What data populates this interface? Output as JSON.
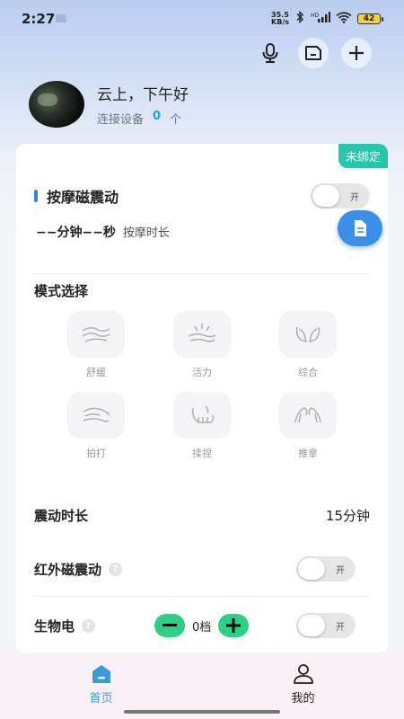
{
  "status_bar": {
    "time": "2:27",
    "net_speed_value": "35.5",
    "net_speed_unit": "KB/s",
    "wifi_tag": "HD",
    "battery": "42"
  },
  "header": {
    "greeting": "云上，下午好",
    "connected_label": "连接设备",
    "connected_count": "0",
    "connected_unit": "个"
  },
  "card": {
    "bind_status": "未绑定",
    "section_title": "按摩磁震动",
    "main_toggle_label": "开",
    "duration_value": "−−分钟−−秒",
    "duration_label": "按摩时长",
    "mode_title": "模式选择",
    "modes": [
      {
        "label": "舒缓",
        "icon": "wave-hand-icon"
      },
      {
        "label": "活力",
        "icon": "sparkle-hand-icon"
      },
      {
        "label": "综合",
        "icon": "two-hands-icon"
      },
      {
        "label": "拍打",
        "icon": "tap-hand-icon"
      },
      {
        "label": "揉捏",
        "icon": "knead-hand-icon"
      },
      {
        "label": "推拿",
        "icon": "push-hands-icon"
      }
    ],
    "vibration_duration_label": "震动时长",
    "vibration_duration_value": "15分钟",
    "infrared_label": "红外磁震动",
    "infrared_toggle_label": "开",
    "bioelectric_label": "生物电",
    "bioelectric_level": "0档",
    "bioelectric_toggle_label": "开"
  },
  "nav": {
    "home_label": "首页",
    "mine_label": "我的",
    "active_color": "#3a9bd8"
  }
}
